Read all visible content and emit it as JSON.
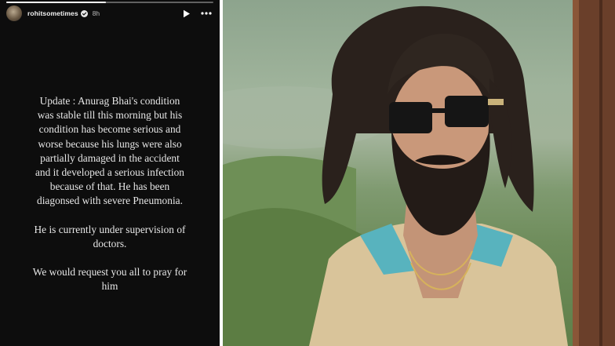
{
  "story": {
    "username": "rohitsometimes",
    "time": "8h",
    "progress": 0.48,
    "icons": {
      "avatar": "profile-avatar",
      "verified": "verified-badge-icon",
      "play": "play-icon",
      "more": "more-options-icon"
    },
    "paragraphs": [
      "Update : Anurag Bhai's condition was stable till this morning but his condition has become serious and worse because his lungs were also partially damaged in the accident and it developed a serious infection because of that. He has been diagonsed with severe Pneumonia.",
      "He is currently under supervision of doctors.",
      "We would request you all to pray for him"
    ]
  },
  "colors": {
    "story_background": "#0d0d0d",
    "story_text": "#e6e6e6",
    "verified_blue": "#3897f0"
  }
}
